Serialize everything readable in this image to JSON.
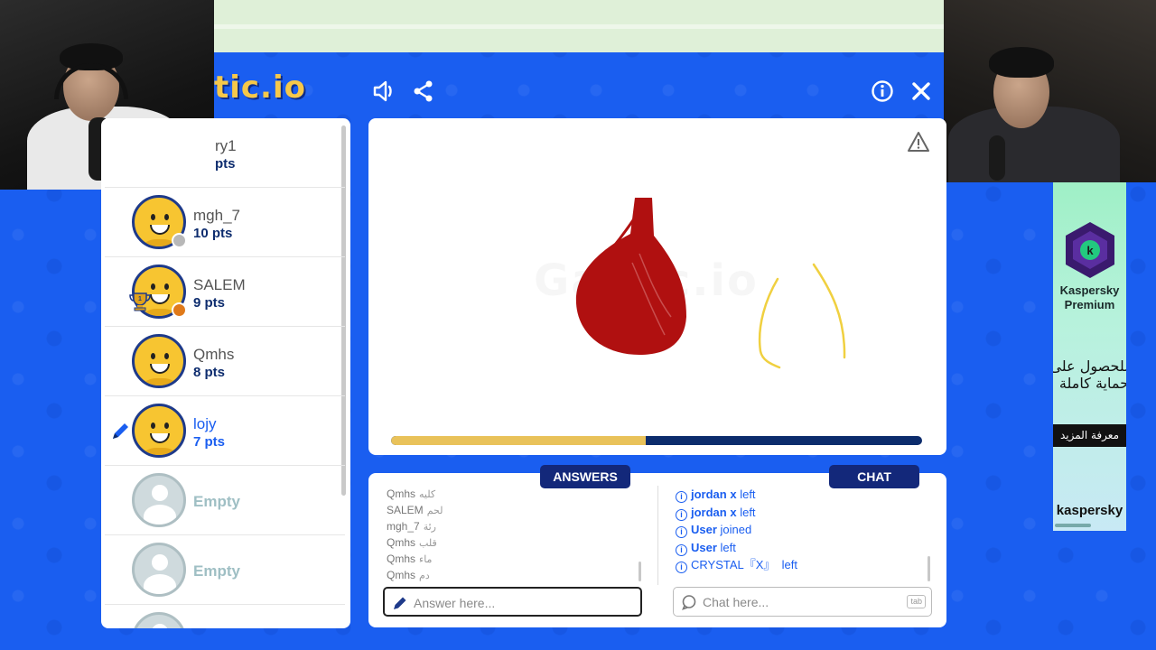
{
  "app": {
    "logo": "tic.io",
    "watermark": "Gartic.io"
  },
  "players": [
    {
      "name": "ry1",
      "points": "pts",
      "partial": true
    },
    {
      "name": "mgh_7",
      "points": "10 pts",
      "status": "gray"
    },
    {
      "name": "SALEM",
      "points": "9 pts",
      "status": "orange",
      "rank": "1"
    },
    {
      "name": "Qmhs",
      "points": "8 pts"
    },
    {
      "name": "lojy",
      "points": "7 pts",
      "drawing": true
    },
    {
      "name": "Empty"
    },
    {
      "name": "Empty"
    }
  ],
  "round": {
    "progress_percent": 48
  },
  "answers": {
    "tab_label": "ANSWERS",
    "items": [
      {
        "user": "Qmhs",
        "text": "كليه"
      },
      {
        "user": "SALEM",
        "text": "لحم"
      },
      {
        "user": "mgh_7",
        "text": "رئة"
      },
      {
        "user": "Qmhs",
        "text": "قلب"
      },
      {
        "user": "Qmhs",
        "text": "ماء"
      },
      {
        "user": "Qmhs",
        "text": "دم"
      }
    ],
    "input_placeholder": "Answer here..."
  },
  "chat": {
    "tab_label": "CHAT",
    "items": [
      {
        "user": "jordan x",
        "action": "left"
      },
      {
        "user": "jordan x",
        "action": "left"
      },
      {
        "user": "User",
        "action": "joined"
      },
      {
        "user": "User",
        "action": "left"
      },
      {
        "user": "CRYSTAL『X』",
        "action": "left"
      }
    ],
    "input_placeholder": "Chat here...",
    "shortcut_key": "tab"
  },
  "ad": {
    "logo_letter": "k",
    "title_line1": "Kaspersky",
    "title_line2": "Premium",
    "arabic_line1": "للحصول على",
    "arabic_line2": "حماية كاملة",
    "cta": "معرفة المزيد",
    "brand": "kaspersky"
  },
  "colors": {
    "background": "#1a5ef0",
    "navy": "#13287a",
    "accent_yellow": "#e9c25a",
    "drawing_red": "#b01010",
    "drawing_yellow": "#f0d040"
  }
}
